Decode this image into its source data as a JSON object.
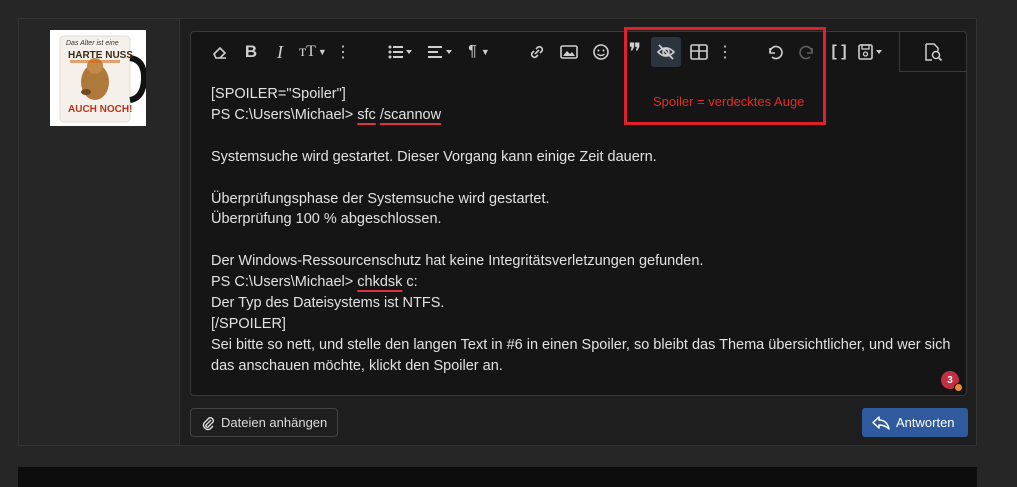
{
  "editor": {
    "lines": [
      "[SPOILER=\"Spoiler\"]",
      "PS C:\\Users\\Michael> ",
      "",
      "Systemsuche wird gestartet. Dieser Vorgang kann einige Zeit dauern.",
      "",
      "Überprüfungsphase der Systemsuche wird gestartet.",
      "Überprüfung 100 % abgeschlossen.",
      "",
      "Der Windows-Ressourcenschutz hat keine Integritätsverletzungen gefunden.",
      "PS C:\\Users\\Michael> ",
      "Der Typ des Dateisystems ist NTFS.",
      "[/SPOILER]",
      "Sei bitte so nett, und stelle den langen Text in #6 in einen Spoiler, so bleibt das Thema übersichtlicher, und wer sich das anschauen möchte, klickt den Spoiler an."
    ],
    "cmd1_a": "sfc",
    "cmd1_b": "/scannow",
    "cmd2_a": "chkdsk",
    "cmd2_b": " c:",
    "notification_count": "3"
  },
  "toolbar": {
    "icons": [
      "eraser-icon",
      "bold-icon",
      "italic-icon",
      "text-size-icon",
      "more-icon",
      "list-icon",
      "align-icon",
      "paragraph-icon",
      "link-icon",
      "image-icon",
      "smiley-icon",
      "quote-icon",
      "spoiler-icon",
      "table-icon",
      "more-icon",
      "undo-icon",
      "redo-icon",
      "bbcode-icon",
      "save-draft-icon",
      "preview-icon"
    ]
  },
  "annotation": {
    "text": "Spoiler = verdecktes Auge",
    "color": "#e0202a"
  },
  "buttons": {
    "attach_label": "Dateien anhängen",
    "reply_label": "Antworten"
  },
  "avatar": {
    "line1": "Das Alter ist eine",
    "line2": "HARTE NUSS",
    "line3": "AUCH NOCH!"
  },
  "colors": {
    "accent": "#2f5a9e",
    "spellcheck": "#e0323c",
    "badge": "#c22f43"
  }
}
